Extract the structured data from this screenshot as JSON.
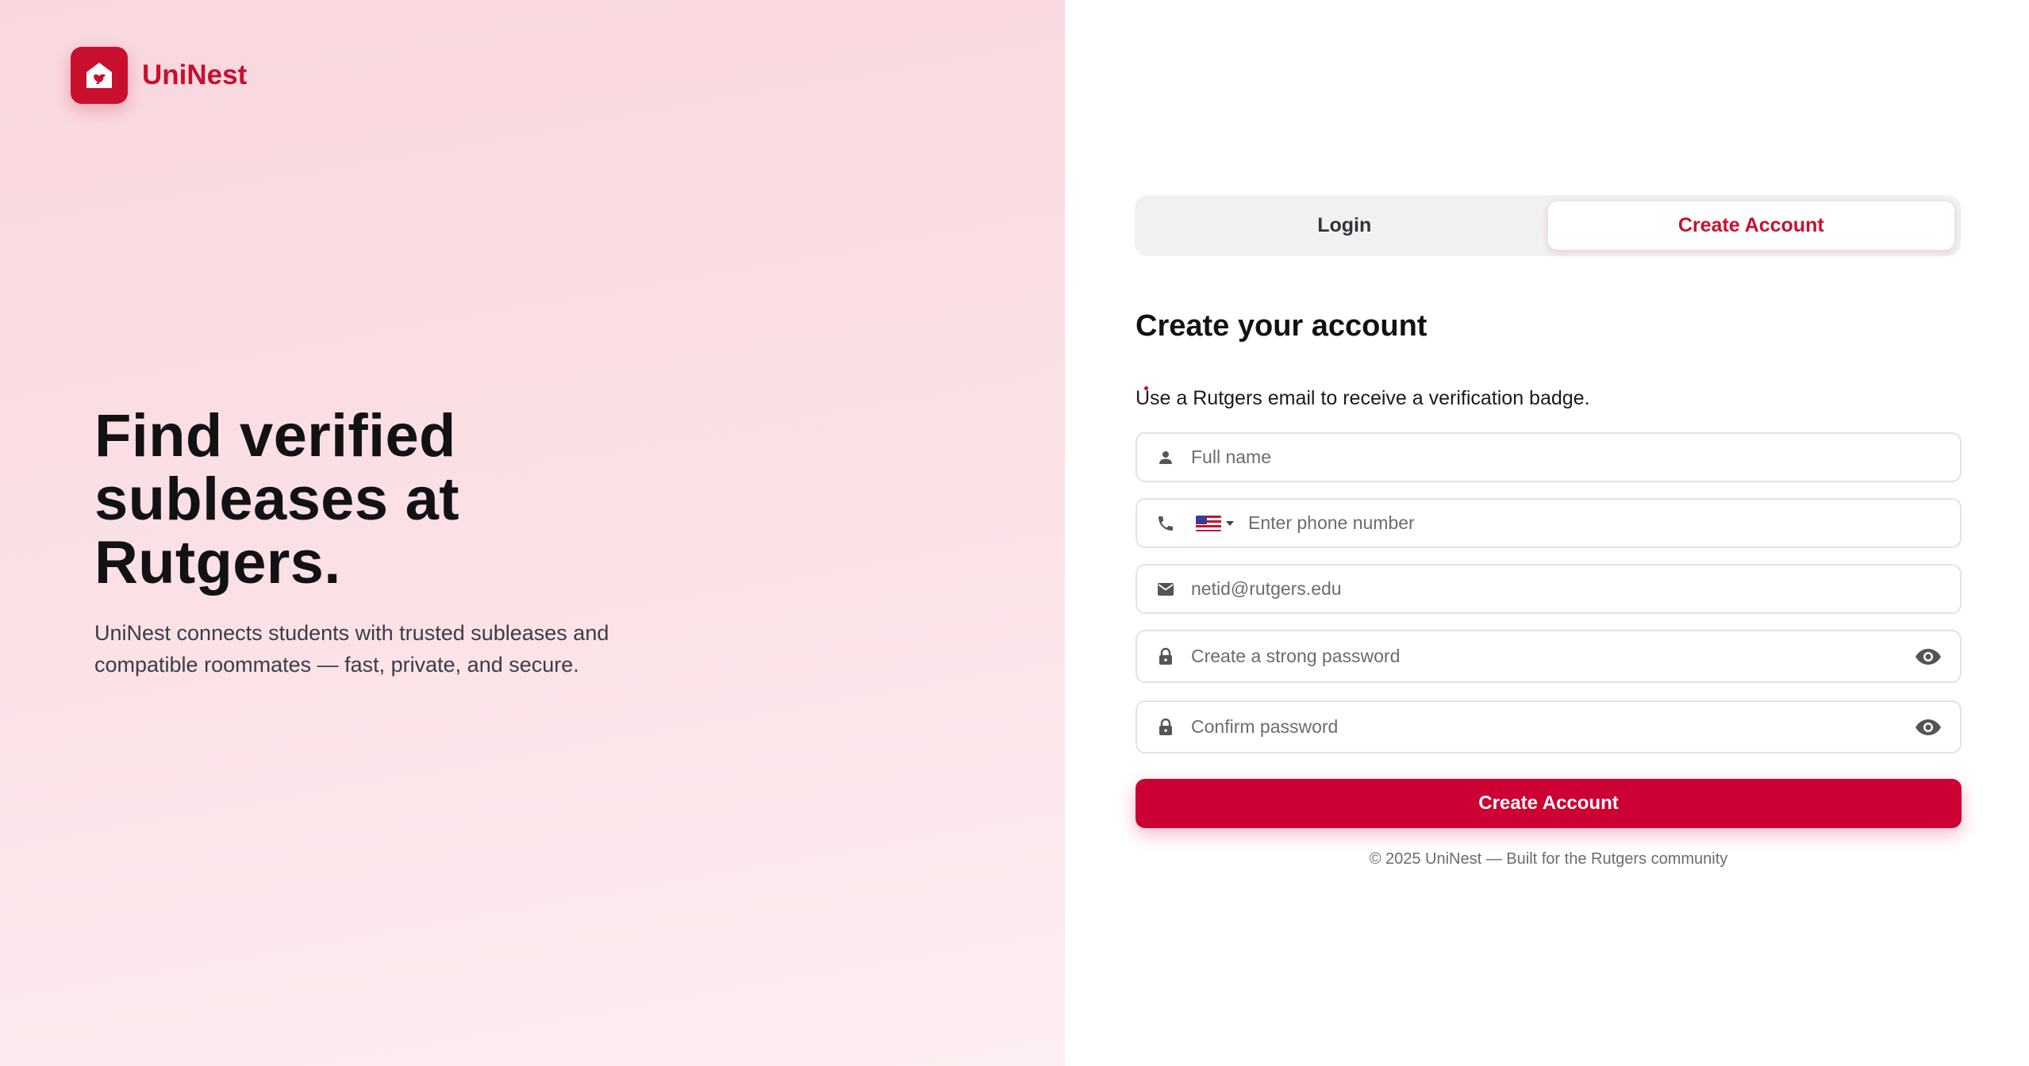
{
  "brand": {
    "name": "UniNest",
    "icon": "house-bird-logo-icon"
  },
  "hero": {
    "title": "Find verified subleases at Rutgers.",
    "subtitle": "UniNest connects students with trusted subleases and compatible roommates — fast, private, and secure."
  },
  "tabs": [
    {
      "label": "Login",
      "active": false
    },
    {
      "label": "Create Account",
      "active": true
    }
  ],
  "form": {
    "title": "Create your account",
    "note": "Use a Rutgers email to receive a verification badge.",
    "fields": {
      "full_name": {
        "placeholder": "Full name",
        "icon": "person-icon"
      },
      "phone": {
        "placeholder": "Enter phone number",
        "icon": "phone-icon",
        "country": "US"
      },
      "email": {
        "placeholder": "netid@rutgers.edu",
        "icon": "mail-icon"
      },
      "password": {
        "placeholder": "Create a strong password",
        "icon": "lock-icon"
      },
      "confirm_password": {
        "placeholder": "Confirm password",
        "icon": "lock-icon"
      }
    },
    "submit_label": "Create Account"
  },
  "footer": {
    "text": "© 2025 UniNest — Built for the Rutgers community"
  },
  "colors": {
    "accent": "#c8102e",
    "button": "#cc0033"
  }
}
